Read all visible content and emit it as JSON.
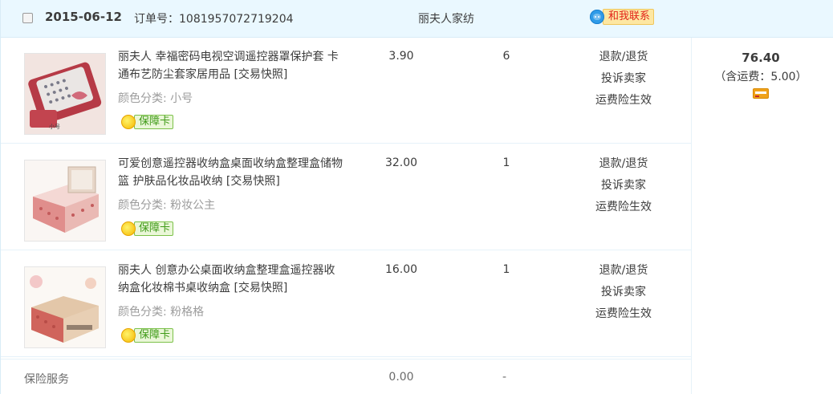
{
  "order": {
    "date": "2015-06-12",
    "order_no": "订单号：1081957072719204",
    "shop": "丽夫人家纺",
    "contact_label": "和我联系",
    "contact_badge": "ww"
  },
  "items": [
    {
      "title": "丽夫人 幸福密码电视空调遥控器罩保护套 卡通布艺防尘套家居用品 [交易快照]",
      "sku": "颜色分类: 小号",
      "guarantee": "保障卡",
      "price": "3.90",
      "qty": "6",
      "ops": [
        "退款/退货",
        "投诉卖家",
        "运费险生效"
      ]
    },
    {
      "title": "可爱创意遥控器收纳盒桌面收纳盒整理盒储物篮 护肤品化妆品收纳 [交易快照]",
      "sku": "颜色分类: 粉妆公主",
      "guarantee": "保障卡",
      "price": "32.00",
      "qty": "1",
      "ops": [
        "退款/退货",
        "投诉卖家",
        "运费险生效"
      ]
    },
    {
      "title": "丽夫人 创意办公桌面收纳盒整理盒遥控器收纳盒化妆棉书桌收纳盒 [交易快照]",
      "sku": "颜色分类: 粉格格",
      "guarantee": "保障卡",
      "price": "16.00",
      "qty": "1",
      "ops": [
        "退款/退货",
        "投诉卖家",
        "运费险生效"
      ]
    }
  ],
  "insurance": {
    "label": "保险服务",
    "price": "0.00",
    "qty": "-"
  },
  "total": {
    "amount": "76.40",
    "shipping": "（含运费：5.00）"
  },
  "colors": {
    "header_bg": "#eaf8ff",
    "border": "#d9ecf7",
    "contact_red": "#e2231a",
    "guarantee_green": "#3e9a17"
  },
  "icons": {
    "contact": "wangwang-chat-icon",
    "guarantee": "guarantee-card-icon",
    "payment": "credit-card-icon"
  }
}
